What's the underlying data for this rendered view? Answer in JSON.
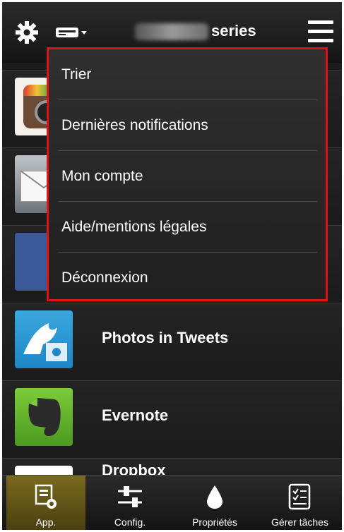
{
  "header": {
    "model_suffix": "series",
    "icons": {
      "settings": "gear-icon",
      "printer": "printer-icon",
      "menu": "hamburger-menu-icon"
    }
  },
  "menu": {
    "items": [
      {
        "label": "Trier"
      },
      {
        "label": "Dernières notifications"
      },
      {
        "label": "Mon compte"
      },
      {
        "label": "Aide/mentions légales"
      },
      {
        "label": "Déconnexion"
      }
    ],
    "highlight_color": "#e01414"
  },
  "apps": [
    {
      "label": "",
      "icon": "instagram-icon"
    },
    {
      "label": "",
      "icon": "mail-icon"
    },
    {
      "label": "",
      "icon": "facebook-icon"
    },
    {
      "label": "Photos in Tweets",
      "icon": "photos-in-tweets-icon"
    },
    {
      "label": "Evernote",
      "icon": "evernote-icon"
    },
    {
      "label": "Dropbox",
      "icon": "dropbox-icon"
    }
  ],
  "bottom_tabs": [
    {
      "label": "App.",
      "icon": "apps-icon",
      "active": true
    },
    {
      "label": "Config.",
      "icon": "sliders-icon",
      "active": false
    },
    {
      "label": "Propriétés",
      "icon": "ink-drop-icon",
      "active": false
    },
    {
      "label": "Gérer tâches",
      "icon": "checklist-icon",
      "active": false
    }
  ]
}
